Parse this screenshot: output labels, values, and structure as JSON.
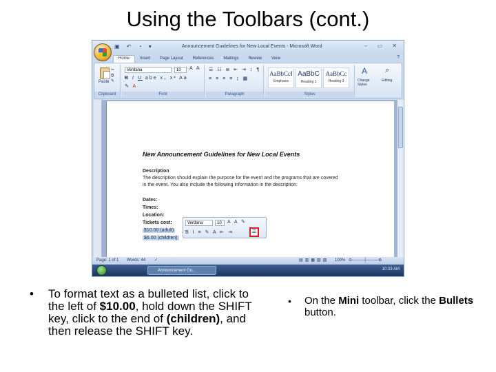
{
  "slide": {
    "title": "Using the Toolbars (cont.)"
  },
  "window": {
    "title": "Announcement Guidelines for New Local Events - Microsoft Word",
    "qat": "▣ ↶ ◔ ▾",
    "controls": "– ▭ ✕"
  },
  "ribbon": {
    "tabs": [
      "Home",
      "Insert",
      "Page Layout",
      "References",
      "Mailings",
      "Review",
      "View"
    ],
    "groups": {
      "clipboard": "Clipboard",
      "font": "Font",
      "paragraph": "Paragraph",
      "styles": "Styles",
      "editing": "Editing"
    },
    "paste_label": "Paste",
    "font_name": "Verdana",
    "font_size": "10",
    "styles": [
      {
        "sample": "AaBbCcI",
        "name": "Emphasis"
      },
      {
        "sample": "AaBbC",
        "name": "Heading 1"
      },
      {
        "sample": "AaBbCc",
        "name": "Heading 3"
      }
    ],
    "change_styles": "Change Styles",
    "editing": "Editing"
  },
  "document": {
    "heading": "New Announcement Guidelines for New Local Events",
    "description_label": "Description",
    "description_line1": "The description should explain the purpose for the event and the programs that are covered",
    "description_line2": "in the event. You also include the following information in the description:",
    "dates": "Dates:",
    "times": "Times:",
    "location": "Location:",
    "tickets": "Tickets cost:",
    "price_adult": "$10.00 (adult)",
    "price_children": "$6.00 (children)"
  },
  "mini_toolbar": {
    "font_name": "Verdana",
    "font_size": "10",
    "row2": "B I ≡ ✎ A ⇤ ⇥",
    "bullets_symbol": "☰"
  },
  "statusbar": {
    "page": "Page: 1 of 1",
    "words": "Words: 44",
    "zoom": "100%"
  },
  "taskbar": {
    "item": "Announcement Gu...",
    "clock": "10:33 AM"
  },
  "instructions": {
    "bullet": "•",
    "left_p1": "To format text as a bulleted list, click to the left of ",
    "left_b1": "$10.00",
    "left_p2": ", hold down the SHIFT key, click to the end of ",
    "left_b2": "(children)",
    "left_p3": ", and then release the SHIFT key.",
    "right_p1": "On the ",
    "right_b1": "Mini",
    "right_p2": " toolbar, click the ",
    "right_b2": "Bullets",
    "right_p3": " button."
  },
  "colors": {
    "ribbon_bg": "#d6e3f3",
    "highlight_box": "#e01b1b",
    "selection": "#c6d4ea"
  }
}
